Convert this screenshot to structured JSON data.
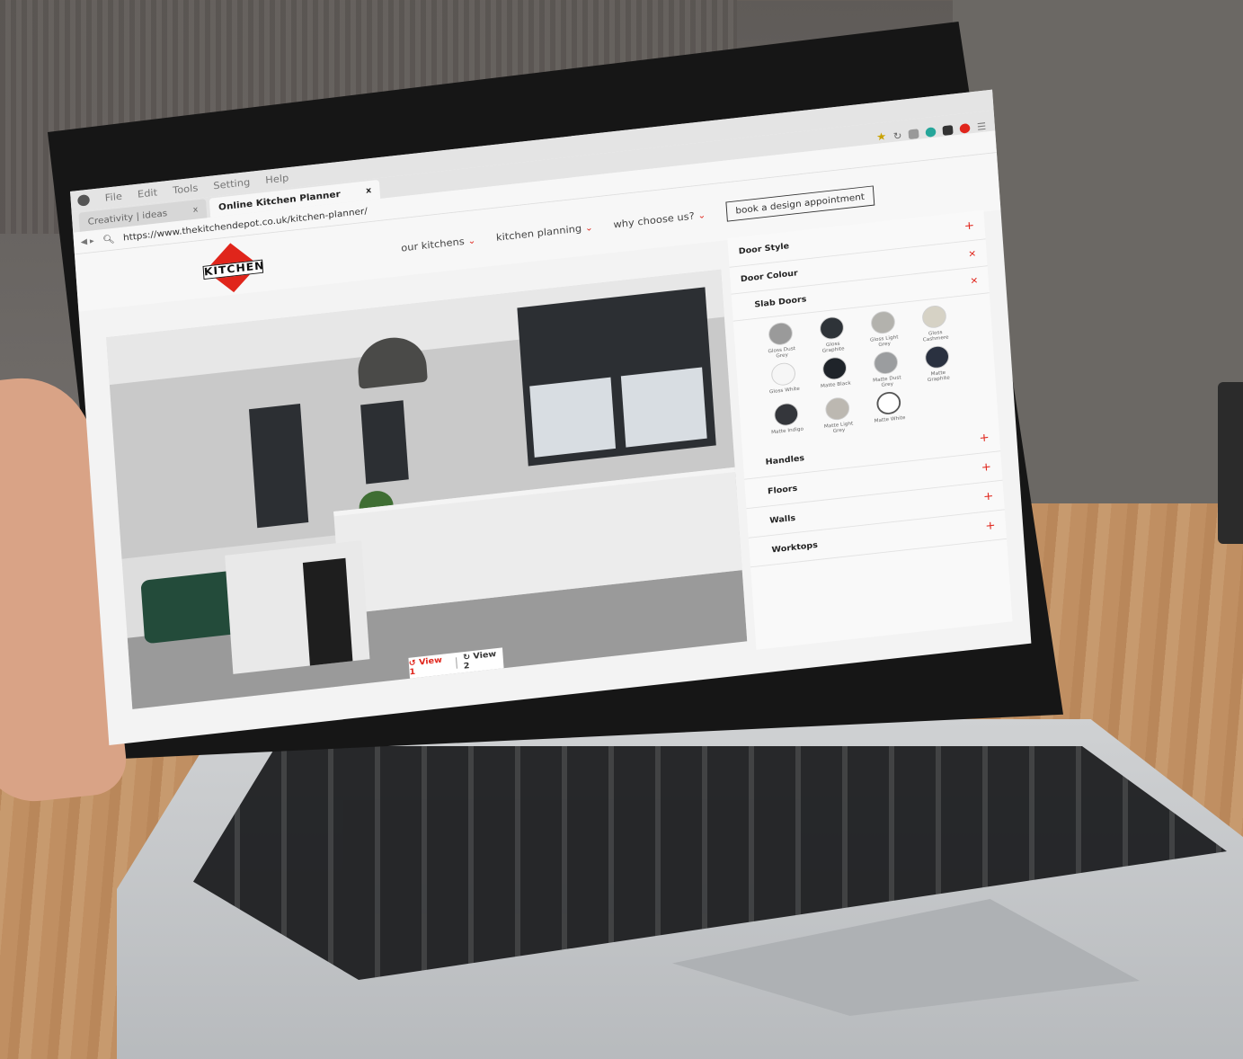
{
  "browser": {
    "menu": [
      "File",
      "Edit",
      "Tools",
      "Setting",
      "Help"
    ],
    "tabs": [
      {
        "label": "Creativity | ideas",
        "close": "x"
      },
      {
        "label": "Online Kitchen Planner",
        "close": "x"
      }
    ],
    "url": "https://www.thekitchendepot.co.uk/kitchen-planner/",
    "icons": [
      "star-icon",
      "reload-icon",
      "extension-icon",
      "chrome-icon",
      "camera-icon",
      "pin-icon",
      "menu-icon"
    ]
  },
  "site": {
    "logo_text": "KITCHEN",
    "nav": [
      {
        "label": "our kitchens"
      },
      {
        "label": "kitchen planning"
      },
      {
        "label": "why choose us?"
      }
    ],
    "cta": "book a design appointment"
  },
  "viewer": {
    "views": [
      {
        "icon": "↺",
        "label": "View 1"
      },
      {
        "icon": "↻",
        "label": "View 2"
      }
    ]
  },
  "panel": {
    "door_style": "Door Style",
    "door_colour": "Door Colour",
    "slab_doors": "Slab Doors",
    "swatches": [
      {
        "name": "Gloss Dust Grey",
        "color": "#9a9a9a"
      },
      {
        "name": "Gloss Graphite",
        "color": "#2e3338"
      },
      {
        "name": "Gloss Light Grey",
        "color": "#b3b2ad"
      },
      {
        "name": "Gloss Cashmere",
        "color": "#d6d2c5"
      },
      {
        "name": "Gloss White",
        "color": "#f6f6f6"
      },
      {
        "name": "Matte Black",
        "color": "#1f242a"
      },
      {
        "name": "Matte Dust Grey",
        "color": "#9b9d9f"
      },
      {
        "name": "Matte Graphite",
        "color": "#2a3140"
      },
      {
        "name": "Matte Indigo",
        "color": "#34363b"
      },
      {
        "name": "Matte Light Grey",
        "color": "#bcb8b1"
      },
      {
        "name": "Matte White",
        "color": "#ffffff"
      }
    ],
    "sections": [
      "Handles",
      "Floors",
      "Walls",
      "Worktops"
    ]
  },
  "colors": {
    "accent": "#e0251b"
  }
}
